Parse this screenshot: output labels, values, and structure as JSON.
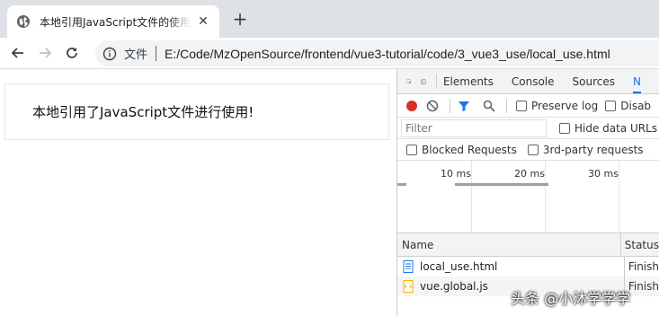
{
  "browser": {
    "tab": {
      "title": "本地引用JavaScript文件的使用方",
      "close": "✕"
    },
    "new_tab": "+",
    "omnibox": {
      "scheme_label": "文件",
      "url": "E:/Code/MzOpenSource/frontend/vue3-tutorial/code/3_vue3_use/local_use.html"
    }
  },
  "page": {
    "message": "本地引用了JavaScript文件进行使用!"
  },
  "devtools": {
    "tabs": [
      "Elements",
      "Console",
      "Sources",
      "N"
    ],
    "active_tab": "N",
    "preserve_log": "Preserve log",
    "disable_cache": "Disab",
    "filter_placeholder": "Filter",
    "hide_data_urls": "Hide data URLs",
    "blocked_requests": "Blocked Requests",
    "third_party": "3rd-party requests",
    "timeline_ticks": [
      "10 ms",
      "20 ms",
      "30 ms"
    ],
    "columns": {
      "name": "Name",
      "status": "Status"
    },
    "requests": [
      {
        "name": "local_use.html",
        "status": "Finish",
        "type": "document"
      },
      {
        "name": "vue.global.js",
        "status": "Finish",
        "type": "script"
      }
    ]
  },
  "watermark": "头条 @小沐学学学",
  "colors": {
    "accent": "#1a73e8",
    "record": "#d93025",
    "tabstrip": "#dee1e6"
  }
}
